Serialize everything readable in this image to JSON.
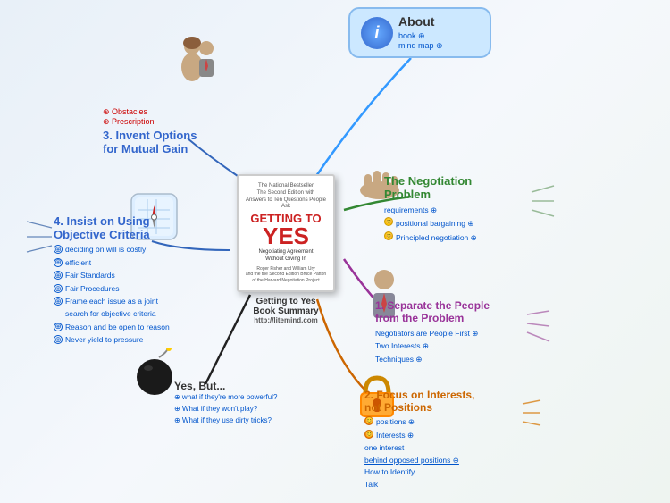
{
  "title": "Getting to Yes Book Summary",
  "url": "http://litemind.com",
  "about": {
    "label": "About",
    "icon": "i",
    "links": [
      "book ⊕",
      "mind map ⊕"
    ]
  },
  "center_book": {
    "subtitle_top": "The National Bestseller\nThe Second Edition with\nAnswers to Ten Questions People Ask",
    "getting_to": "GETTING TO",
    "yes": "YES",
    "negotiating": "Negotiating Agreement\nWithout Giving In",
    "author": "Roger Fisher and William Ury\nand the the Second Edition Bruce Patton\nof the Harvard Negotiation Project",
    "summary_label": "Getting to Yes",
    "book_summary": "Book Summary",
    "url": "http://litemind.com"
  },
  "node3": {
    "obstacles_label": "⊕ Obstacles",
    "prescription_label": "⊕ Prescription",
    "title": "3. Invent Options\nfor Mutual Gain"
  },
  "node4": {
    "title": "4. Insist on Using\nObjective Criteria",
    "items": [
      "deciding on will is costly",
      "efficient",
      "Fair Standards",
      "Fair Procedures",
      "Frame each issue as a joint\nsearch for objective criteria",
      "Reason and be open to reason",
      "Never yield to pressure"
    ]
  },
  "yes_but": {
    "title": "Yes, But...",
    "items": [
      "what if they're more powerful?",
      "What if they won't play?",
      "What if they use dirty tricks?"
    ]
  },
  "negotiation_problem": {
    "title": "The Negotiation\nProblem",
    "items": [
      "requirements ⊕",
      "positional bargaining ⊕",
      "Principled negotiation ⊕"
    ]
  },
  "separate_people": {
    "title": "1. Separate the People\nfrom the Problem",
    "items": [
      "Negotiators are People First ⊕",
      "Two Interests ⊕",
      "Techniques ⊕"
    ]
  },
  "focus_interests": {
    "title": "2. Focus on Interests,\nnot Positions",
    "items": [
      "positions ⊕",
      "Interests ⊕",
      "one interest",
      "behind opposed positions ⊕",
      "How to Identify",
      "Talk"
    ]
  }
}
